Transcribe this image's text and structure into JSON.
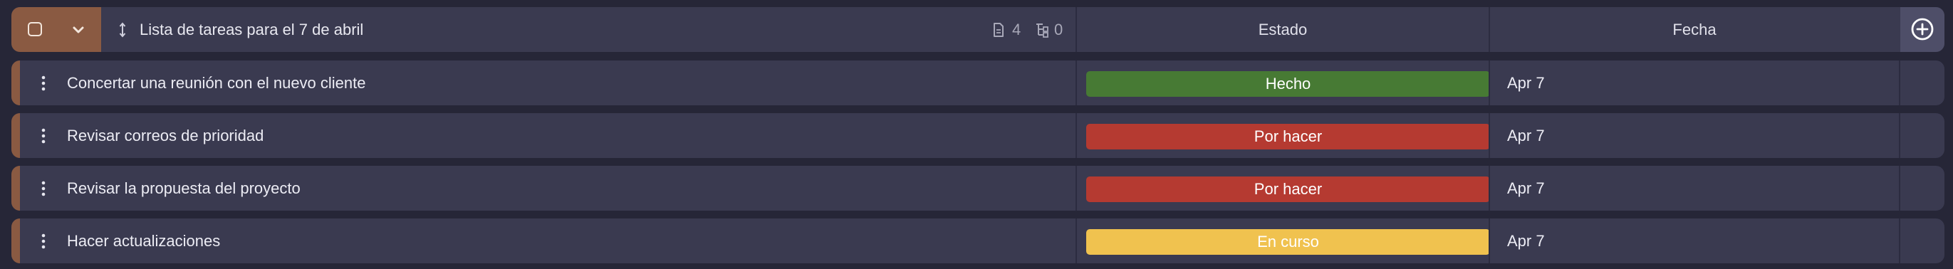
{
  "header": {
    "title": "Lista de tareas para el 7 de abril",
    "docs_count": "4",
    "subitems_count": "0",
    "col_estado": "Estado",
    "col_fecha": "Fecha"
  },
  "tasks": [
    {
      "name": "Concertar una reunión con el nuevo cliente",
      "status": "Hecho",
      "status_color": "#477a34",
      "date": "Apr 7"
    },
    {
      "name": "Revisar correos de prioridad",
      "status": "Por hacer",
      "status_color": "#b53a31",
      "date": "Apr 7"
    },
    {
      "name": "Revisar la propuesta del proyecto",
      "status": "Por hacer",
      "status_color": "#b53a31",
      "date": "Apr 7"
    },
    {
      "name": "Hacer actualizaciones",
      "status": "En curso",
      "status_color": "#f0c24f",
      "date": "Apr 7"
    }
  ],
  "colors": {
    "background": "#262637",
    "row": "#3a3a50",
    "accent": "#8a5a42"
  },
  "icons": {
    "header_checkbox": "checkbox-icon",
    "collapse": "chevron-down-icon",
    "drag": "drag-handle-icon",
    "docs": "document-icon",
    "subitems": "subitems-icon",
    "add_column": "plus-circle-icon",
    "row_menu": "vertical-dots-icon"
  }
}
